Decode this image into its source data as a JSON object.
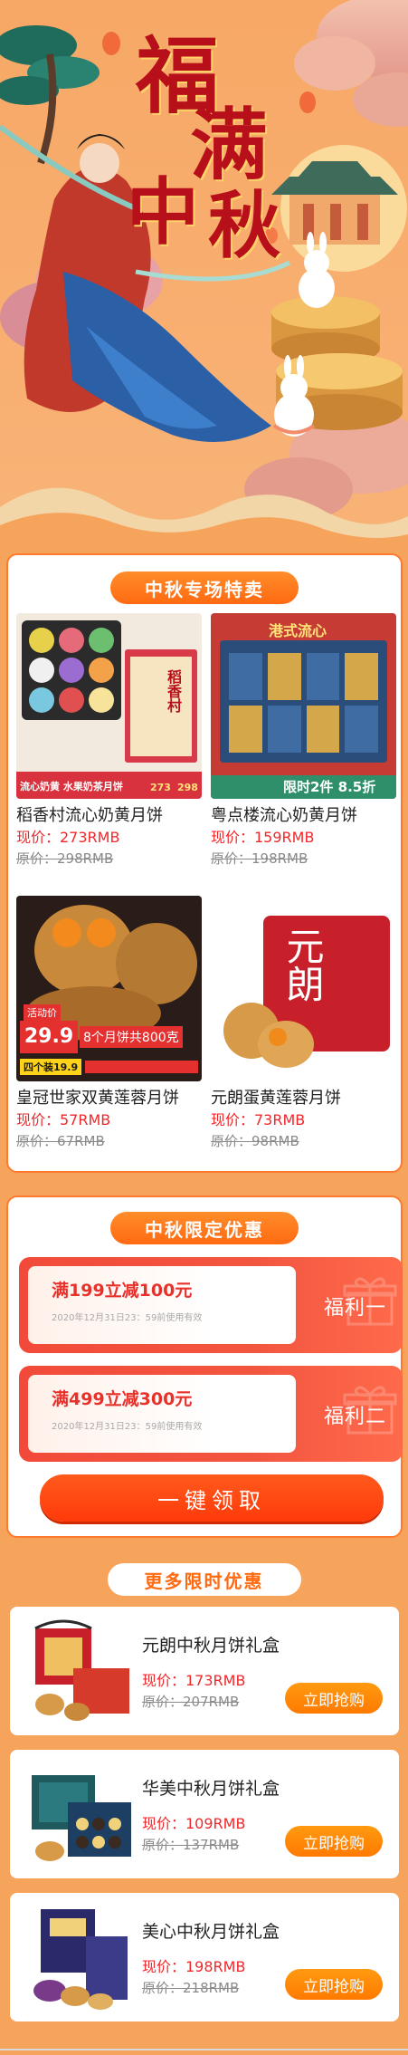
{
  "colors": {
    "page_bg": "#f6a35b",
    "accent": "#ff6a12",
    "price_red": "#f0282b",
    "coupon_red": "#f24a3a"
  },
  "hero": {
    "title_chars": [
      "福",
      "满",
      "中",
      "秋"
    ]
  },
  "special": {
    "heading": "中秋专场特卖",
    "products": [
      {
        "name": "稻香村流心奶黄月饼",
        "price": "现价：273RMB",
        "orig": "原价：298RMB",
        "img_banner": "流心奶黄 水果奶茶月饼",
        "img_brand": "稻香村",
        "img_price_a": "273",
        "img_price_b": "298"
      },
      {
        "name": "粤点楼流心奶黄月饼",
        "price": "现价：159RMB",
        "orig": "原价：198RMB",
        "img_banner": "限时2件 8.5折",
        "img_head": "港式流心"
      },
      {
        "name": "皇冠世家双黄莲蓉月饼",
        "price": "现价：57RMB",
        "orig": "原价：67RMB",
        "img_tag": "活动价",
        "img_big": "29.9",
        "img_sub": "8个月饼共800克",
        "img_small": "四个装19.9"
      },
      {
        "name": "元朗蛋黄莲蓉月饼",
        "price": "现价：73RMB",
        "orig": "原价：98RMB",
        "img_brand": "元朗"
      }
    ]
  },
  "limited": {
    "heading": "中秋限定优惠",
    "coupons": [
      {
        "title": "满199立减100元",
        "valid": "2020年12月31日23：59前使用有效",
        "tag": "福利一"
      },
      {
        "title": "满499立减300元",
        "valid": "2020年12月31日23：59前使用有效",
        "tag": "福利二"
      }
    ],
    "claim_label": "一键领取"
  },
  "more": {
    "heading": "更多限时优惠",
    "offers": [
      {
        "name": "元朗中秋月饼礼盒",
        "price": "现价：173RMB",
        "orig": "原价：207RMB",
        "button": "立即抢购"
      },
      {
        "name": "华美中秋月饼礼盒",
        "price": "现价：109RMB",
        "orig": "原价：137RMB",
        "button": "立即抢购"
      },
      {
        "name": "美心中秋月饼礼盒",
        "price": "现价：198RMB",
        "orig": "原价：218RMB",
        "button": "立即抢购"
      }
    ]
  }
}
